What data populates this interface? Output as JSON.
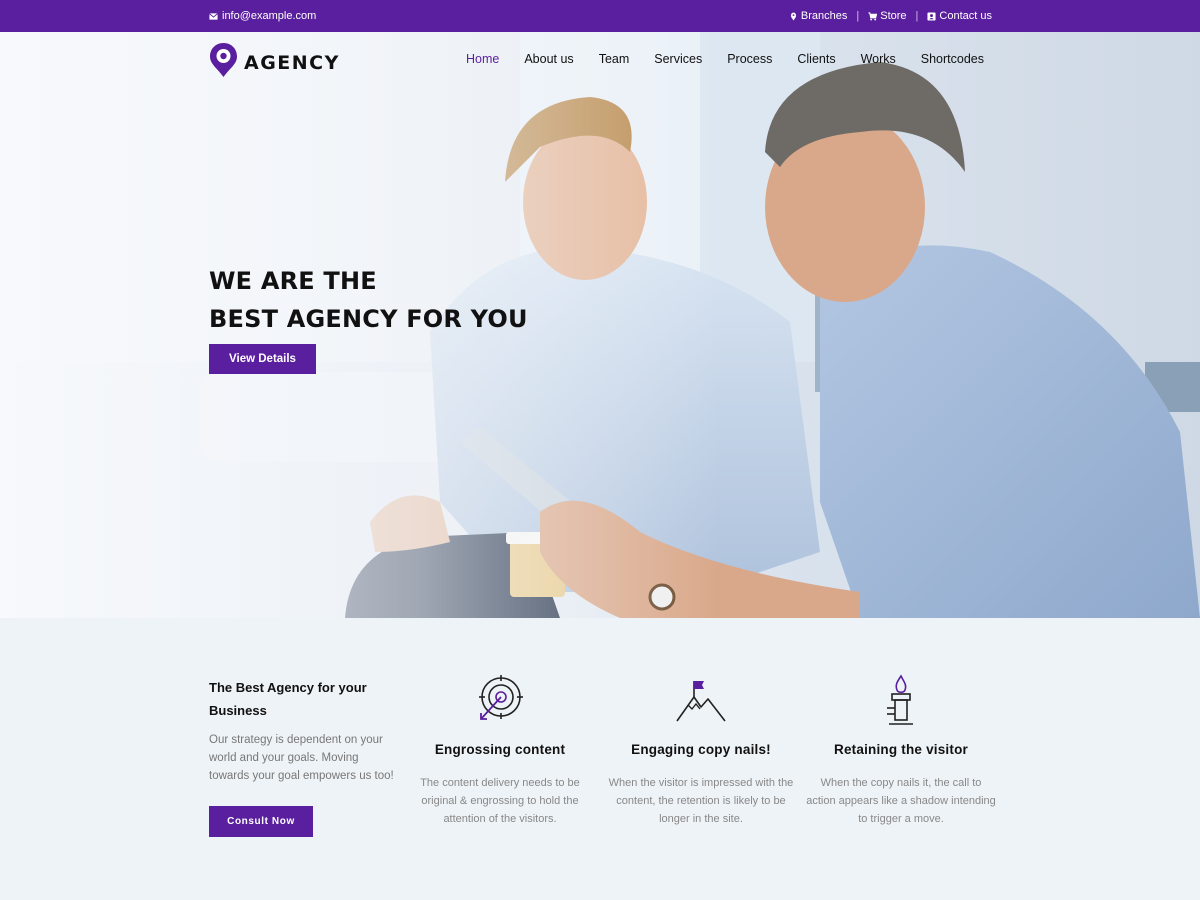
{
  "topbar": {
    "email": "info@example.com",
    "links": [
      {
        "label": "Branches",
        "icon": "map-marker-icon"
      },
      {
        "label": "Store",
        "icon": "cart-icon"
      },
      {
        "label": "Contact us",
        "icon": "contact-card-icon"
      }
    ]
  },
  "header": {
    "logo_text": "AGENCY",
    "nav": [
      {
        "label": "Home",
        "active": true
      },
      {
        "label": "About us"
      },
      {
        "label": "Team"
      },
      {
        "label": "Services"
      },
      {
        "label": "Process"
      },
      {
        "label": "Clients"
      },
      {
        "label": "Works"
      },
      {
        "label": "Shortcodes"
      }
    ]
  },
  "hero": {
    "title_line1": "WE ARE THE",
    "title_line2": "BEST AGENCY FOR YOU",
    "button": "View Details"
  },
  "features": {
    "intro": {
      "title": "The Best Agency for your Business",
      "text": "Our strategy is dependent on your world and your goals. Moving towards your goal empowers us too!",
      "button": "Consult Now"
    },
    "items": [
      {
        "icon": "target-icon",
        "title": "Engrossing content",
        "text": "The content delivery needs to be original & engrossing to hold the attention of the visitors."
      },
      {
        "icon": "mountain-flag-icon",
        "title": "Engaging copy nails!",
        "text": "When the visitor is impressed with the content, the retention is likely to be longer in the site."
      },
      {
        "icon": "torch-icon",
        "title": "Retaining the visitor",
        "text": "When the copy nails it, the call to action appears like a shadow intending to trigger a move."
      }
    ]
  },
  "colors": {
    "brand": "#5a1f9e",
    "background": "#eef3f7"
  }
}
